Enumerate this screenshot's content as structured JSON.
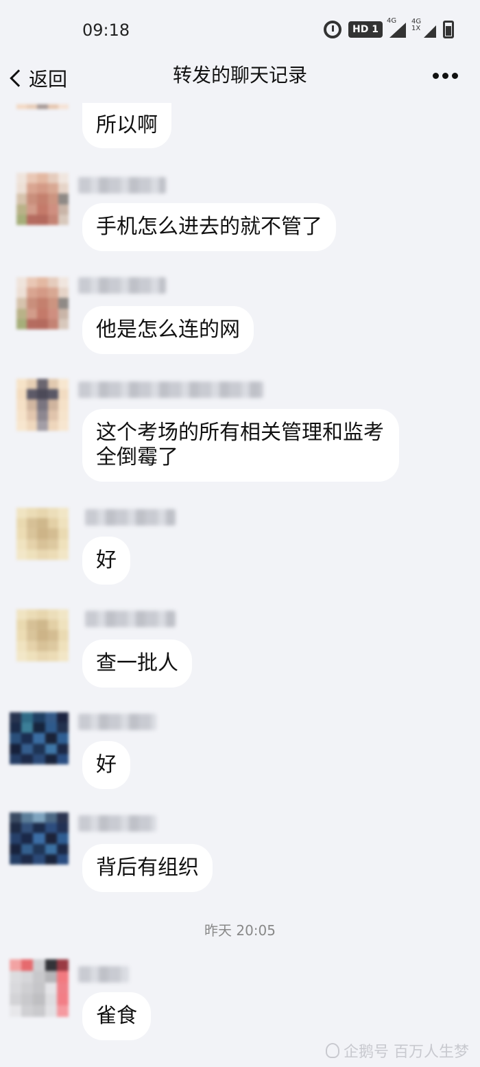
{
  "status_bar": {
    "time": "09:18",
    "hd_label": "HD 1",
    "signal1_tag": "4G",
    "signal2_tag": "4G 1X"
  },
  "nav": {
    "back_label": "返回",
    "title": "转发的聊天记录",
    "more_icon": "more-icon"
  },
  "colors": {
    "background": "#f2f3f7",
    "bubble": "#ffffff"
  },
  "messages": [
    {
      "text": "所以啊"
    },
    {
      "text": "手机怎么进去的就不管了"
    },
    {
      "text": "他是怎么连的网"
    },
    {
      "text": "这个考场的所有相关管理和监考全倒霉了"
    },
    {
      "text": "好"
    },
    {
      "text": "查一批人"
    },
    {
      "text": "好"
    },
    {
      "text": "背后有组织"
    },
    {
      "text": "雀食"
    }
  ],
  "time_divider": "昨天 20:05",
  "watermark": {
    "text": "企鹅号 百万人生梦",
    "icon": "penguin-icon"
  }
}
